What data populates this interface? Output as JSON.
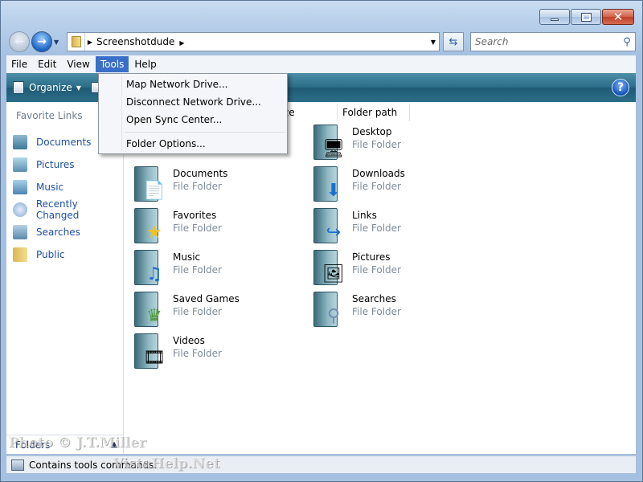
{
  "window": {
    "caption": {
      "minimize": "minimize-icon",
      "maximize": "maximize-icon",
      "close": "close-icon"
    }
  },
  "nav": {
    "address": {
      "folder": "Screenshotdude"
    },
    "search": {
      "placeholder": "Search"
    }
  },
  "menubar": {
    "items": [
      "File",
      "Edit",
      "View",
      "Tools",
      "Help"
    ],
    "active": "Tools"
  },
  "commandbar": {
    "organize": "Organize"
  },
  "tools_menu": {
    "items": [
      "Map Network Drive...",
      "Disconnect Network Drive...",
      "Open Sync Center...",
      "Folder Options..."
    ]
  },
  "favorite_links": {
    "title": "Favorite Links",
    "items": [
      "Documents",
      "Pictures",
      "Music",
      "Recently Changed",
      "Searches",
      "Public"
    ]
  },
  "folders_bar": {
    "label": "Folders"
  },
  "columns": {
    "size": "ze",
    "path": "Folder path"
  },
  "files": [
    {
      "name": "Desktop",
      "type": "File Folder"
    },
    {
      "name": "Documents",
      "type": "File Folder"
    },
    {
      "name": "Downloads",
      "type": "File Folder"
    },
    {
      "name": "Favorites",
      "type": "File Folder"
    },
    {
      "name": "Links",
      "type": "File Folder"
    },
    {
      "name": "Music",
      "type": "File Folder"
    },
    {
      "name": "Pictures",
      "type": "File Folder"
    },
    {
      "name": "Saved Games",
      "type": "File Folder"
    },
    {
      "name": "Searches",
      "type": "File Folder"
    },
    {
      "name": "Videos",
      "type": "File Folder"
    }
  ],
  "status": {
    "text": "Contains tools commands."
  },
  "watermarks": {
    "line1": "Photo © J.T.Miller",
    "line2": "VistaHelp.Net"
  }
}
